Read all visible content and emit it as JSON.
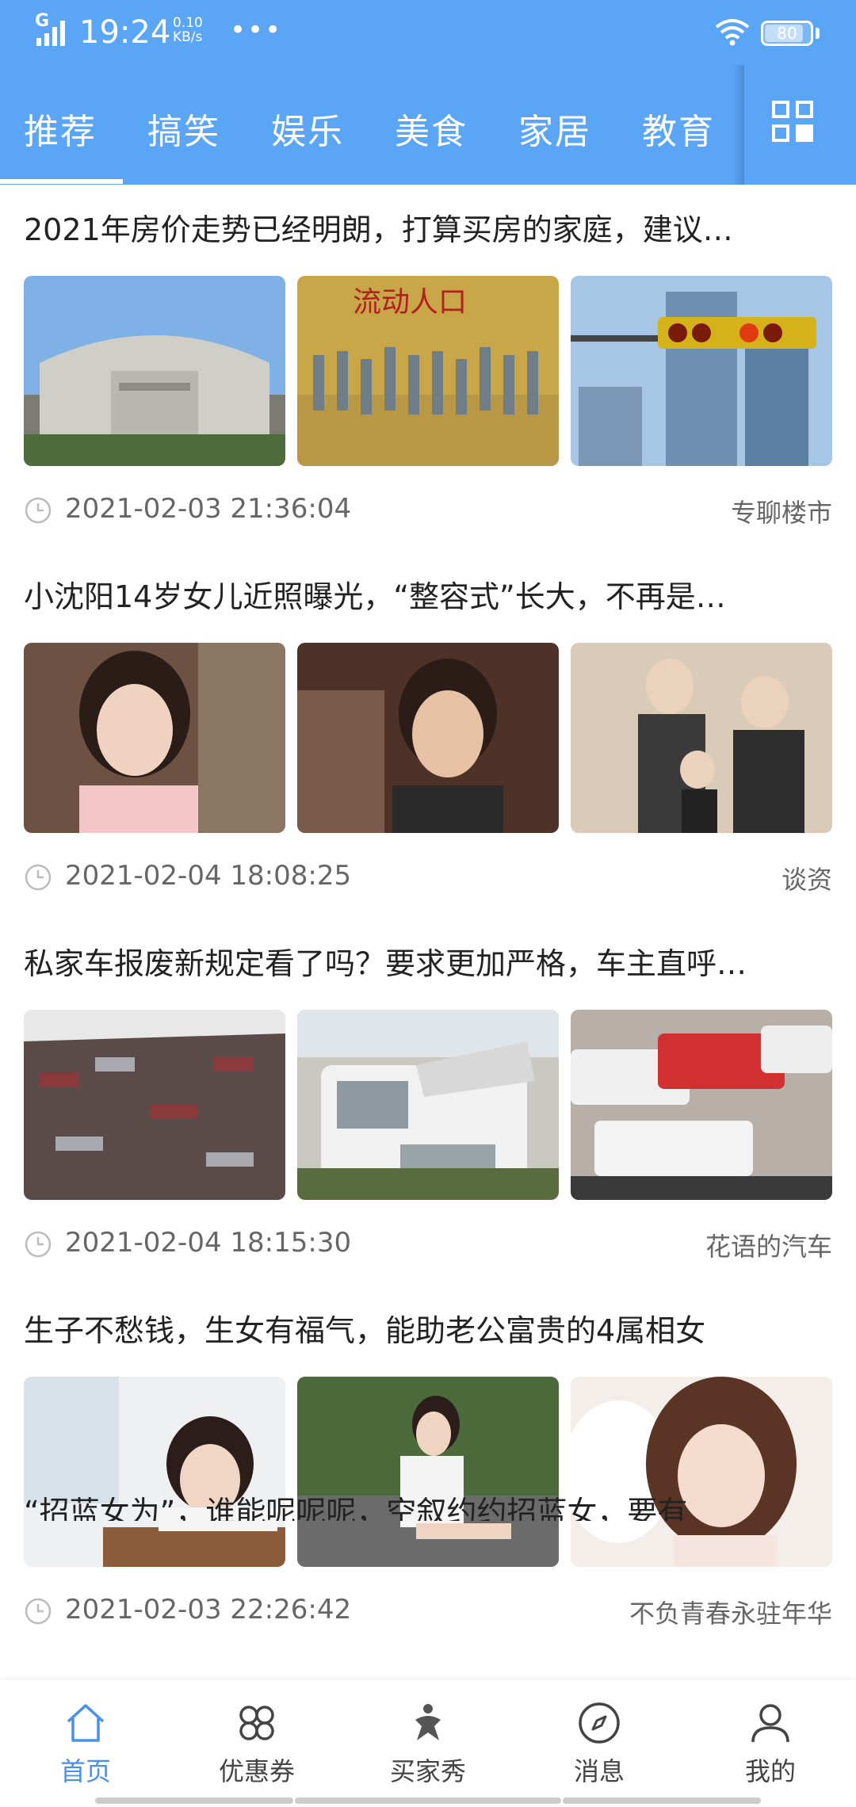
{
  "status_bar": {
    "network": "G",
    "time": "19:24",
    "speed_value": "0.10",
    "speed_unit": "KB/s",
    "more": "•••",
    "battery": "80"
  },
  "tabs": [
    {
      "label": "推荐",
      "active": true
    },
    {
      "label": "搞笑",
      "active": false
    },
    {
      "label": "娱乐",
      "active": false
    },
    {
      "label": "美食",
      "active": false
    },
    {
      "label": "家居",
      "active": false
    },
    {
      "label": "教育",
      "active": false
    }
  ],
  "articles": [
    {
      "title": "2021年房价走势已经明朗，打算买房的家庭，建议…",
      "time": "2021-02-03 21:36:04",
      "source": "专聊楼市",
      "images": [
        {
          "icon": "bank-building-photo",
          "overlay_text": ""
        },
        {
          "icon": "floating-population-photo",
          "overlay_text": "流动人口"
        },
        {
          "icon": "traffic-light-city-photo",
          "overlay_text": ""
        }
      ]
    },
    {
      "title": "小沈阳14岁女儿近照曝光，“整容式”长大，不再是…",
      "time": "2021-02-04 18:08:25",
      "source": "谈资",
      "images": [
        {
          "icon": "girl-portrait-photo",
          "overlay_text": ""
        },
        {
          "icon": "child-portrait-photo",
          "overlay_text": ""
        },
        {
          "icon": "family-photo",
          "overlay_text": ""
        }
      ]
    },
    {
      "title": "私家车报废新规定看了吗？要求更加严格，车主直呼…",
      "time": "2021-02-04 18:15:30",
      "source": "花语的汽车",
      "images": [
        {
          "icon": "scrapyard-photo",
          "overlay_text": ""
        },
        {
          "icon": "scrapped-van-photo",
          "overlay_text": ""
        },
        {
          "icon": "scrapped-cars-photo",
          "overlay_text": ""
        }
      ]
    },
    {
      "title": "生子不愁钱，生女有福气，能助老公富贵的4属相女",
      "time": "2021-02-03 22:26:42",
      "source": "不负青春永驻年华",
      "images": [
        {
          "icon": "woman-desk-photo",
          "overlay_text": ""
        },
        {
          "icon": "woman-sitting-photo",
          "overlay_text": ""
        },
        {
          "icon": "woman-portrait-photo",
          "overlay_text": ""
        }
      ]
    }
  ],
  "partial_title": "“招蓝女为”，谁能呢呢呢，空叙约约招蓝女，要有",
  "bottom_nav": [
    {
      "label": "首页",
      "icon": "home-icon",
      "active": true
    },
    {
      "label": "优惠券",
      "icon": "coupon-icon",
      "active": false
    },
    {
      "label": "买家秀",
      "icon": "buyer-show-icon",
      "active": false
    },
    {
      "label": "消息",
      "icon": "compass-icon",
      "active": false
    },
    {
      "label": "我的",
      "icon": "profile-icon",
      "active": false
    }
  ],
  "colors": {
    "header": "#5aa5f5",
    "accent": "#4a90e8",
    "meta_text": "#666666"
  }
}
